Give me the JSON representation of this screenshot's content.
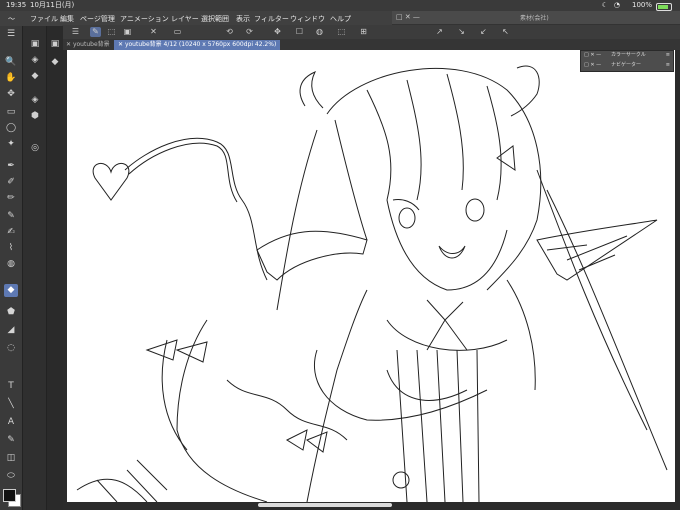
{
  "status": {
    "time": "19:35",
    "date": "10月11日(月)",
    "battery": "100%"
  },
  "menu": [
    "ファイル",
    "編集",
    "ページ管理",
    "アニメーション",
    "レイヤー",
    "選択範囲",
    "表示",
    "フィルター",
    "ウィンドウ",
    "ヘルプ"
  ],
  "float_window": {
    "title": "素材(会社)",
    "controls": "□ ✕ —"
  },
  "tabs": [
    {
      "label": "youtube背景",
      "close": "✕"
    },
    {
      "label": "youtube背景 4/12 (10240 x 5760px 600dpi 42.2%)",
      "close": "✕"
    }
  ],
  "panels": [
    {
      "label": "カラーサークル",
      "controls": "□ ✕ —",
      "more": "≡"
    },
    {
      "label": "ナビゲーター",
      "controls": "□ ✕ —",
      "more": "≡"
    }
  ],
  "tools_left": [
    "☰",
    "⌂",
    "✎",
    "🔍",
    "✋",
    "✥",
    "▭",
    "◯",
    "✦",
    "⬚",
    "✒",
    "✐",
    "✏",
    "✎",
    "✍",
    "⌇",
    "◍",
    "✿",
    "◆",
    "⬟",
    "◢",
    "◌",
    "T",
    "╲",
    "A",
    "✎",
    "◫",
    "⬭",
    "⌂"
  ],
  "tools_sub": [
    "▣",
    "◈",
    "◆",
    "◈",
    "⬢",
    "◎"
  ],
  "toolbar_icons": [
    "☰",
    "✎",
    "⬚",
    "▣",
    "✕",
    "▭",
    "⟲",
    "⟳",
    "✥",
    "☐",
    "◍",
    "⬚",
    "⊞",
    "↗",
    "↘",
    "↙",
    "↖"
  ],
  "colors": {
    "accent": "#5e79b3",
    "canvas": "#ffffff",
    "dark": "#2b2b2b"
  }
}
